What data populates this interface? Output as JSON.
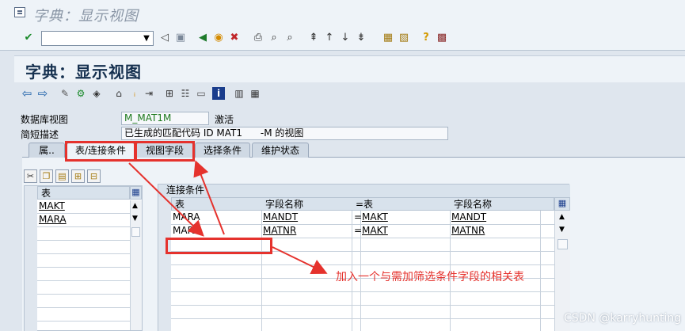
{
  "window": {
    "title": "字典：显示视图"
  },
  "app": {
    "title": "字典：显示视图"
  },
  "header_fields": {
    "db_view_label": "数据库视图",
    "db_view_value": "M_MAT1M",
    "db_view_status": "激活",
    "short_desc_label": "简短描述",
    "short_desc_value": "已生成的匹配代码 ID MAT1      -M 的视图"
  },
  "tabs": [
    {
      "label": "属.."
    },
    {
      "label": "表/连接条件"
    },
    {
      "label": "视图字段"
    },
    {
      "label": "选择条件"
    },
    {
      "label": "维护状态"
    }
  ],
  "tables_list": {
    "header": "表",
    "rows": [
      "MAKT",
      "MARA"
    ]
  },
  "join_conditions": {
    "title": "连接条件",
    "columns": [
      "表",
      "字段名称",
      "=",
      "表",
      "字段名称"
    ],
    "rows": [
      [
        "MARA",
        "MANDT",
        "=",
        "MAKT",
        "MANDT"
      ],
      [
        "MARA",
        "MATNR",
        "=",
        "MAKT",
        "MATNR"
      ]
    ]
  },
  "annotation": {
    "text": "加入一个与需加筛选条件字段的相关表"
  },
  "watermark": "CSDN @karryhunting",
  "colors": {
    "annotation_red": "#e5322d",
    "title_blue": "#15304f",
    "link_blue": "#0a3a8c"
  }
}
